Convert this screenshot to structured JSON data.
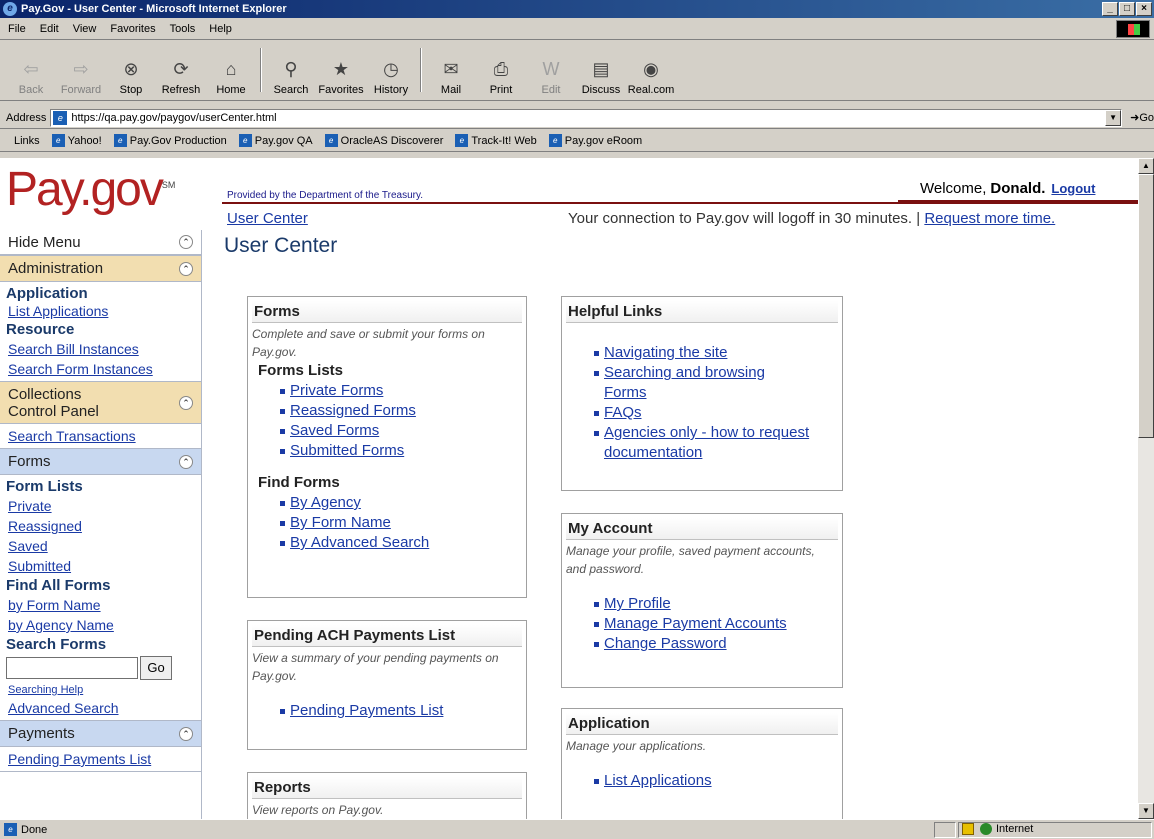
{
  "window": {
    "title": "Pay.Gov - User Center - Microsoft Internet Explorer",
    "min": "_",
    "max": "□",
    "close": "×"
  },
  "menu": [
    "File",
    "Edit",
    "View",
    "Favorites",
    "Tools",
    "Help"
  ],
  "toolbar": {
    "back": "Back",
    "forward": "Forward",
    "stop": "Stop",
    "refresh": "Refresh",
    "home": "Home",
    "search": "Search",
    "favorites": "Favorites",
    "history": "History",
    "mail": "Mail",
    "print": "Print",
    "edit": "Edit",
    "discuss": "Discuss",
    "realcom": "Real.com"
  },
  "address": {
    "label": "Address",
    "url": "https://qa.pay.gov/paygov/userCenter.html",
    "go": "Go"
  },
  "links": {
    "label": "Links",
    "items": [
      "Yahoo!",
      "Pay.Gov Production",
      "Pay.gov QA",
      "OracleAS Discoverer",
      "Track-It! Web",
      "Pay.gov eRoom"
    ]
  },
  "header": {
    "logo": "Pay.gov",
    "sm": "SM",
    "provided": "Provided by the Department of the Treasury.",
    "welcome": "Welcome,",
    "user": "Donald.",
    "logout": "Logout",
    "breadcrumb": "User Center",
    "timeout": "Your connection to Pay.gov will logoff in 30 minutes. |",
    "request_more": "Request more time."
  },
  "page_title": "User Center",
  "sidebar": {
    "hide_menu": "Hide Menu",
    "administration": {
      "label": "Administration",
      "application": "Application",
      "list_applications": "List Applications",
      "resource": "Resource",
      "search_bill": "Search Bill Instances",
      "search_form": "Search Form Instances"
    },
    "collections": {
      "label_1": "Collections",
      "label_2": "Control Panel",
      "search_transactions": "Search Transactions"
    },
    "forms": {
      "label": "Forms",
      "form_lists": "Form Lists",
      "private": "Private",
      "reassigned": "Reassigned",
      "saved": "Saved",
      "submitted": "Submitted",
      "find_all": "Find All Forms",
      "by_form_name": "by Form Name",
      "by_agency_name": "by Agency Name",
      "search_forms": "Search Forms",
      "go": "Go",
      "searching_help": "Searching Help",
      "advanced_search": "Advanced Search"
    },
    "payments": {
      "label": "Payments",
      "pending_list": "Pending Payments List"
    }
  },
  "boxes": {
    "forms": {
      "title": "Forms",
      "desc": "Complete and save or submit your forms on Pay.gov.",
      "lists_title": "Forms Lists",
      "lists": [
        "Private Forms",
        "Reassigned Forms",
        "Saved Forms",
        "Submitted Forms"
      ],
      "find_title": "Find Forms",
      "find": [
        "By Agency",
        "By Form Name",
        "By Advanced Search"
      ]
    },
    "pending": {
      "title": "Pending ACH Payments List",
      "desc": "View a summary of your pending payments on Pay.gov.",
      "items": [
        "Pending Payments List"
      ]
    },
    "reports": {
      "title": "Reports",
      "desc": "View reports on Pay.gov."
    },
    "helpful": {
      "title": "Helpful Links",
      "items": [
        "Navigating the site",
        "Searching and browsing Forms",
        "FAQs",
        "Agencies only - how to request documentation"
      ]
    },
    "account": {
      "title": "My Account",
      "desc": "Manage your profile, saved payment accounts, and password.",
      "items": [
        "My Profile",
        "Manage Payment Accounts",
        "Change Password"
      ]
    },
    "application": {
      "title": "Application",
      "desc": "Manage your applications.",
      "items": [
        "List Applications"
      ]
    }
  },
  "status": {
    "text": "Done",
    "zone": "Internet"
  }
}
